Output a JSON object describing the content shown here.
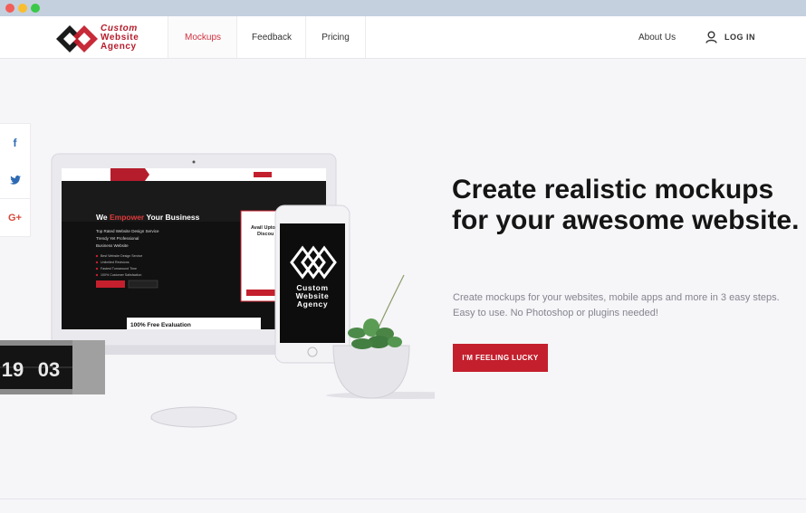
{
  "logo": {
    "line1": "Custom",
    "line2": "Website",
    "line3": "Agency"
  },
  "nav": {
    "tabs": [
      "Mockups",
      "Feedback",
      "Pricing"
    ],
    "active": "Mockups",
    "about": "About Us",
    "login": "LOG IN"
  },
  "social": {
    "items": [
      {
        "icon": "facebook-icon",
        "glyph": "f"
      },
      {
        "icon": "twitter-icon",
        "glyph": "🐦"
      },
      {
        "icon": "google-plus-icon",
        "glyph": "G+"
      }
    ]
  },
  "hero": {
    "headline": "Create realistic mockups for your awesome website.",
    "subtext": "Create mockups for your websites, mobile apps and more in 3 easy steps. Easy to use. No Photoshop or plugins needed!",
    "cta": "I'M FEELING LUCKY"
  },
  "mockup": {
    "site_heading_pre": "We ",
    "site_heading_accent": "Empower",
    "site_heading_post": " Your Business",
    "site_bullets": [
      "Top Rated Website Design Service",
      "Trendy Yet Professional",
      "Business Website"
    ],
    "site_features": [
      "Best Website Design Service",
      "Unlimited Revisions",
      "Fastest Turnaround Time",
      "100% Customer Satisfaction"
    ],
    "form_title": "Avail Upto",
    "form_title2": "Discou",
    "evaluation": "100% Free Evaluation",
    "phone_brand": [
      "Custom",
      "Website",
      "Agency"
    ],
    "clock_hours": "19",
    "clock_minutes": "03"
  },
  "colors": {
    "accent": "#c41f2d",
    "nav_active": "#d2313f",
    "social": "#2d6ab3"
  }
}
